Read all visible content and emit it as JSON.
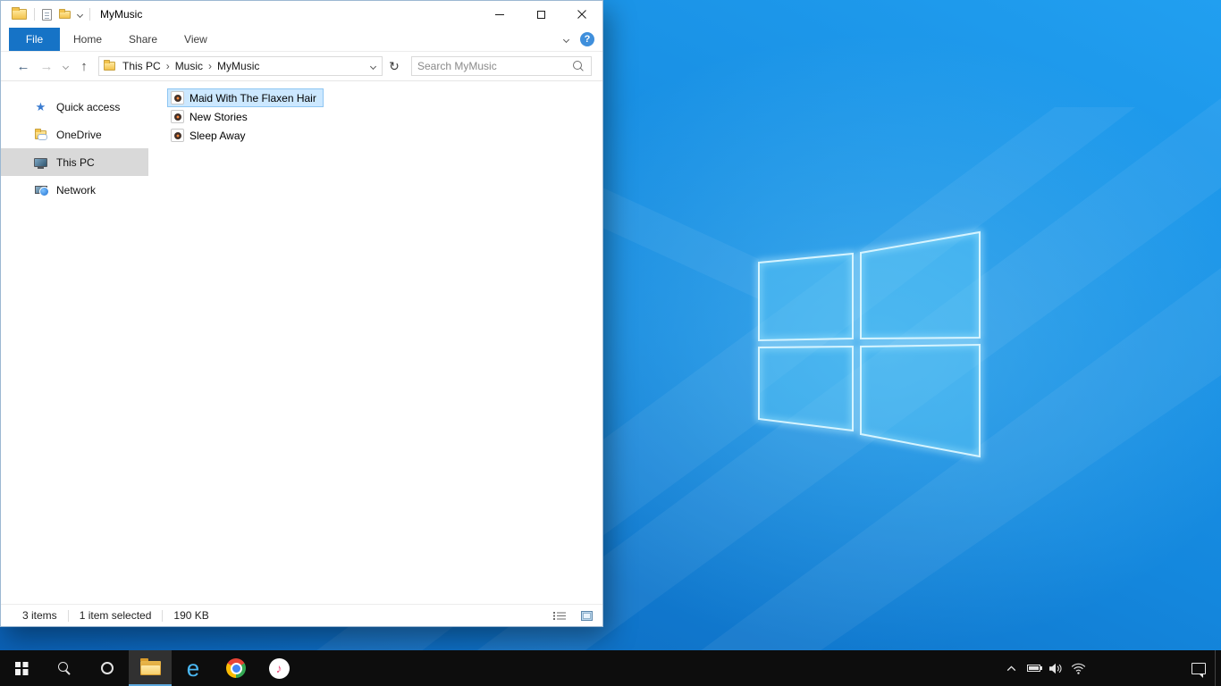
{
  "window": {
    "title": "MyMusic"
  },
  "ribbon": {
    "file_tab": "File",
    "tabs": [
      "Home",
      "Share",
      "View"
    ],
    "help_label": "?"
  },
  "navigation": {
    "breadcrumb": [
      "This PC",
      "Music",
      "MyMusic"
    ],
    "search_placeholder": "Search MyMusic"
  },
  "sidebar": {
    "items": [
      {
        "label": "Quick access",
        "icon": "quick-access-star"
      },
      {
        "label": "OneDrive",
        "icon": "onedrive-folder"
      },
      {
        "label": "This PC",
        "icon": "computer",
        "selected": true
      },
      {
        "label": "Network",
        "icon": "network-computer"
      }
    ]
  },
  "file_list": {
    "items": [
      {
        "name": "Maid With The Flaxen Hair",
        "icon": "audio-file",
        "selected": true
      },
      {
        "name": "New Stories",
        "icon": "audio-file",
        "selected": false
      },
      {
        "name": "Sleep Away",
        "icon": "audio-file",
        "selected": false
      }
    ]
  },
  "status_bar": {
    "item_count": "3 items",
    "selection": "1 item selected",
    "selection_size": "190 KB"
  },
  "taskbar": {
    "apps": [
      "start",
      "search",
      "cortana",
      "file-explorer",
      "internet-explorer",
      "chrome",
      "itunes"
    ],
    "active_app": "file-explorer",
    "tray": [
      "hidden-icons-chevron",
      "battery",
      "volume",
      "wifi",
      "action-center",
      "show-desktop"
    ]
  },
  "icons": {
    "back": "←",
    "forward": "→",
    "up": "↑",
    "refresh": "↻",
    "breadcrumb_separator": "›",
    "quick_access_star": "★",
    "ie_letter": "e",
    "itunes_note": "♪"
  },
  "colors": {
    "accent_blue": "#1673c6",
    "selection_fill": "#cce8ff",
    "selection_border": "#8ec6f2",
    "sidebar_selected": "#d9d9d9",
    "taskbar_bg": "#0d0d0d",
    "wallpaper_blue": "#1487dd"
  }
}
